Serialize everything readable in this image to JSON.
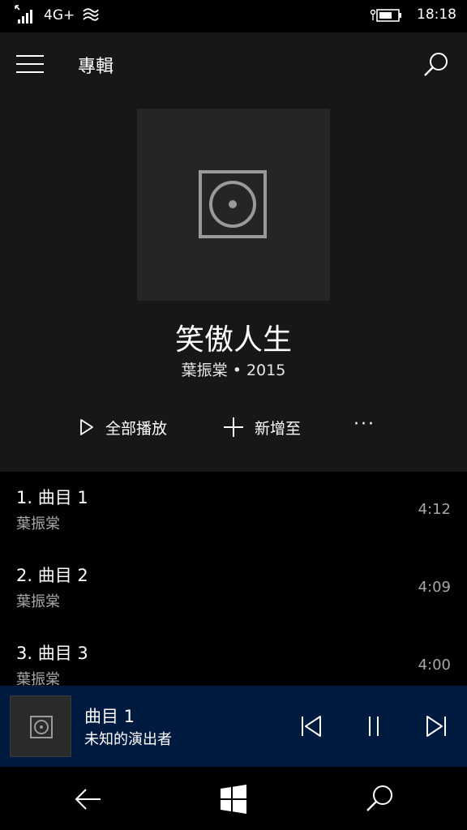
{
  "status_bar": {
    "network": "4G+",
    "time": "18:18"
  },
  "header": {
    "title": "專輯",
    "menu_icon": "hamburger-menu-icon",
    "search_icon": "search-icon"
  },
  "album": {
    "title": "笑傲人生",
    "subtitle": "葉振棠 • 2015",
    "art_icon": "album-placeholder-icon"
  },
  "actions": {
    "play_all": "全部播放",
    "add_to": "新增至",
    "more": "···"
  },
  "tracks": [
    {
      "title": "1. 曲目 1",
      "artist": "葉振棠",
      "duration": "4:12"
    },
    {
      "title": "2. 曲目 2",
      "artist": "葉振棠",
      "duration": "4:09"
    },
    {
      "title": "3. 曲目 3",
      "artist": "葉振棠",
      "duration": "4:00"
    }
  ],
  "now_playing": {
    "title": "曲目 1",
    "artist": "未知的演出者",
    "prev_icon": "skip-previous-icon",
    "pause_icon": "pause-icon",
    "next_icon": "skip-next-icon"
  },
  "nav": {
    "back_icon": "back-arrow-icon",
    "home_icon": "windows-logo-icon",
    "search_icon": "search-icon"
  },
  "colors": {
    "header_bg": "#171717",
    "list_bg": "#000000",
    "now_playing_bg": "#001a40",
    "secondary_text": "#a6a6a6"
  }
}
